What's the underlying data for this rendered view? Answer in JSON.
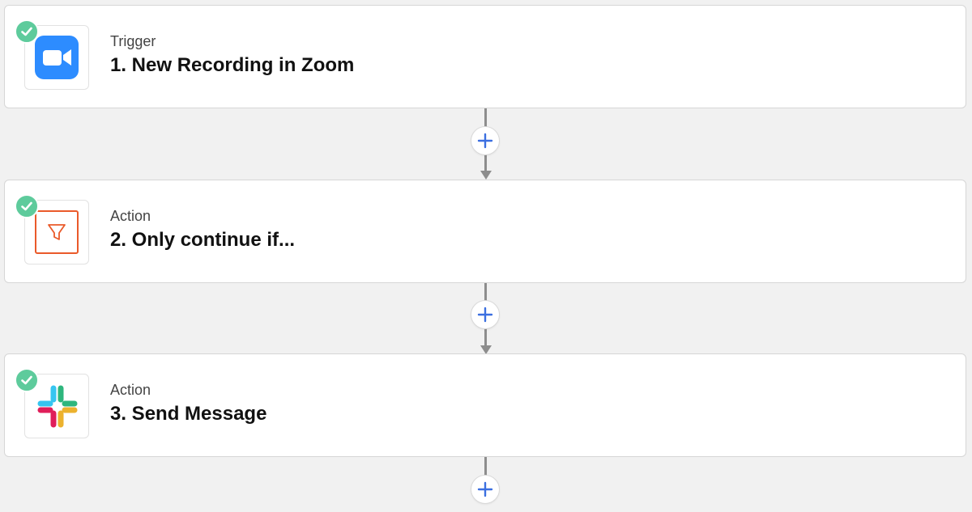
{
  "colors": {
    "background": "#f1f1f1",
    "check": "#5ecb9c",
    "plus": "#3b6fe0",
    "connector": "#8d8d8d",
    "zoom": "#2d8cff",
    "filter": "#ea5a2a"
  },
  "steps": [
    {
      "type": "Trigger",
      "title": "1. New Recording in Zoom",
      "icon": "zoom-icon",
      "status": "complete"
    },
    {
      "type": "Action",
      "title": "2. Only continue if...",
      "icon": "filter-icon",
      "status": "complete"
    },
    {
      "type": "Action",
      "title": "3. Send Message",
      "icon": "slack-icon",
      "status": "complete"
    }
  ],
  "add_step_icon": "plus-icon"
}
